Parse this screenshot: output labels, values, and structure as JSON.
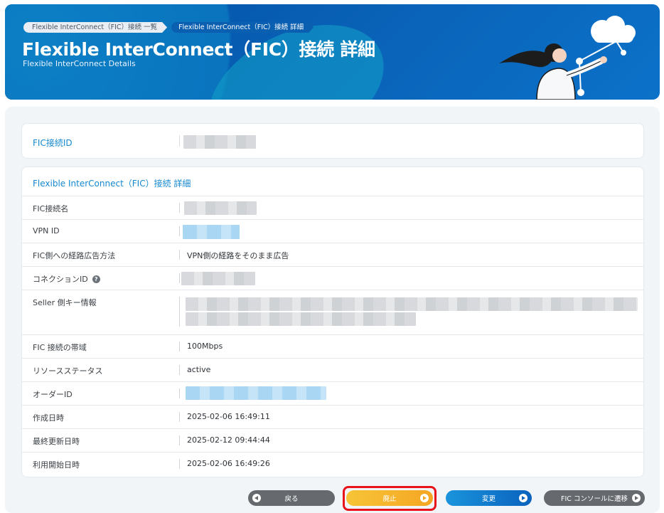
{
  "header": {
    "breadcrumbs": [
      "Flexible InterConnect（FIC）接続 一覧",
      "Flexible InterConnect（FIC）接続 詳細"
    ],
    "title": "Flexible InterConnect（FIC）接続 詳細",
    "subtitle": "Flexible InterConnect Details"
  },
  "id_panel": {
    "label": "FIC接続ID"
  },
  "detail_panel": {
    "title": "Flexible InterConnect（FIC）接続 詳細",
    "rows": [
      {
        "label": "FIC接続名",
        "value": ""
      },
      {
        "label": "VPN ID",
        "value": ""
      },
      {
        "label": "FIC側への経路広告方法",
        "value": "VPN側の経路をそのまま広告"
      },
      {
        "label": "コネクションID",
        "value": ""
      },
      {
        "label": "Seller 側キー情報",
        "value": ""
      },
      {
        "label": "FIC 接続の帯域",
        "value": "100Mbps"
      },
      {
        "label": "リソースステータス",
        "value": "active"
      },
      {
        "label": "オーダーID",
        "value": ""
      },
      {
        "label": "作成日時",
        "value": "2025-02-06 16:49:11"
      },
      {
        "label": "最終更新日時",
        "value": "2025-02-12 09:44:44"
      },
      {
        "label": "利用開始日時",
        "value": "2025-02-06 16:49:26"
      }
    ]
  },
  "buttons": {
    "back": "戻る",
    "delete": "廃止",
    "change": "変更",
    "fic_console": "FIC コンソールに遷移"
  },
  "colors": {
    "accent": "#1589d0",
    "highlight": "#e8131b",
    "delete_btn": "#f5a623"
  }
}
